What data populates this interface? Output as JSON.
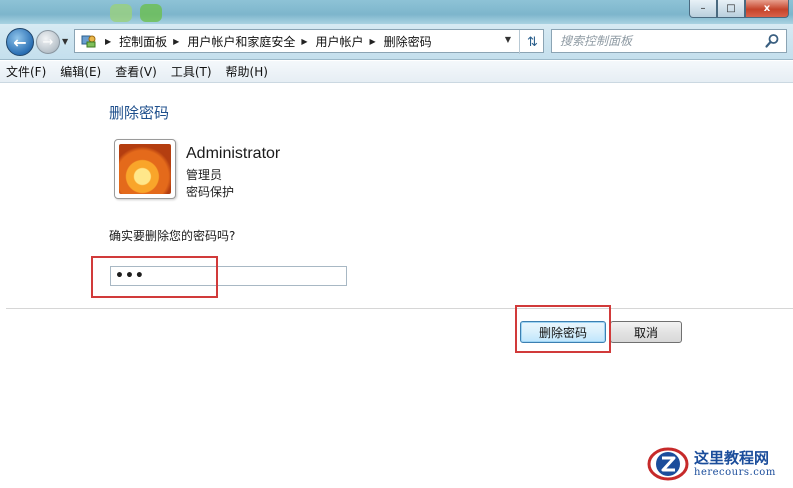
{
  "window": {
    "minimize_label": "–",
    "maximize_label": "□",
    "close_label": "x"
  },
  "nav": {
    "back_icon": "back-arrow-icon",
    "forward_icon": "forward-arrow-icon",
    "refresh_icon": "refresh-icon"
  },
  "breadcrumb": {
    "items": [
      "控制面板",
      "用户帐户和家庭安全",
      "用户帐户",
      "删除密码"
    ]
  },
  "search": {
    "placeholder": "搜索控制面板"
  },
  "menu": {
    "items": [
      "文件(F)",
      "编辑(E)",
      "查看(V)",
      "工具(T)",
      "帮助(H)"
    ]
  },
  "page": {
    "title": "删除密码",
    "user_name": "Administrator",
    "user_role": "管理员",
    "user_status": "密码保护",
    "question": "确实要删除您的密码吗?",
    "password_value": "•••"
  },
  "buttons": {
    "confirm_label": "删除密码",
    "cancel_label": "取消"
  },
  "watermark": {
    "title": "这里教程网",
    "subtitle": "herecours.com"
  },
  "colors": {
    "title_blue": "#1e4f8c",
    "highlight_red": "#d13a3a"
  }
}
